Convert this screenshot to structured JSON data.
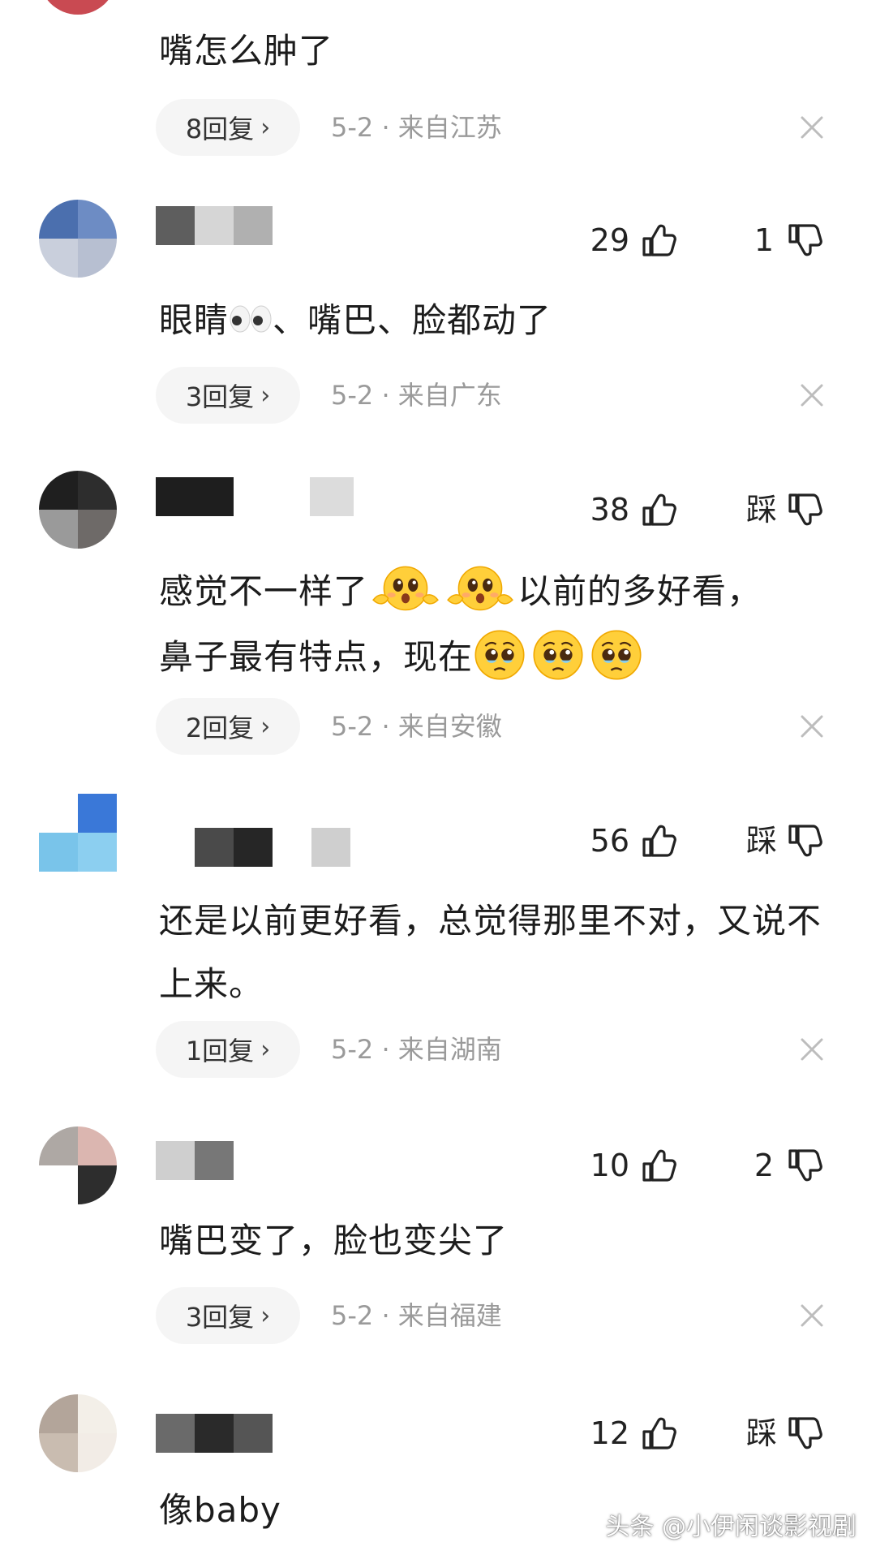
{
  "comments": [
    {
      "text": "嘴怎么肿了",
      "reply_label": "8回复",
      "meta": "5-2 · 来自江苏"
    },
    {
      "likes": "29",
      "dislike": "1",
      "text_before": "眼睛",
      "text_after": "、嘴巴、脸都动了",
      "reply_label": "3回复",
      "meta": "5-2 · 来自广东"
    },
    {
      "likes": "38",
      "dislike": "踩",
      "line1_before": "感觉不一样了",
      "line1_after": "以前的多好看，",
      "line2_before": "鼻子最有特点，现在",
      "reply_label": "2回复",
      "meta": "5-2 · 来自安徽"
    },
    {
      "likes": "56",
      "dislike": "踩",
      "text": "还是以前更好看，总觉得那里不对，又说不上来。",
      "reply_label": "1回复",
      "meta": "5-2 · 来自湖南"
    },
    {
      "likes": "10",
      "dislike": "2",
      "text": "嘴巴变了，脸也变尖了",
      "reply_label": "3回复",
      "meta": "5-2 · 来自福建"
    },
    {
      "likes": "12",
      "dislike": "踩",
      "text": "像baby"
    }
  ],
  "chevron": "›",
  "watermark": "头条 @小伊闲谈影视剧",
  "icons": {
    "like": "thumbs-up-icon",
    "dislike": "thumbs-down-icon",
    "close": "close-icon",
    "emoji_eyes": "eyes-emoji",
    "emoji_shocked": "shocked-face-emoji",
    "emoji_pleading": "pleading-face-emoji"
  },
  "colors": {
    "meta_text": "#9a9a9a",
    "pill_bg": "#f5f5f5",
    "emoji_yellow": "#ffcf3a"
  }
}
